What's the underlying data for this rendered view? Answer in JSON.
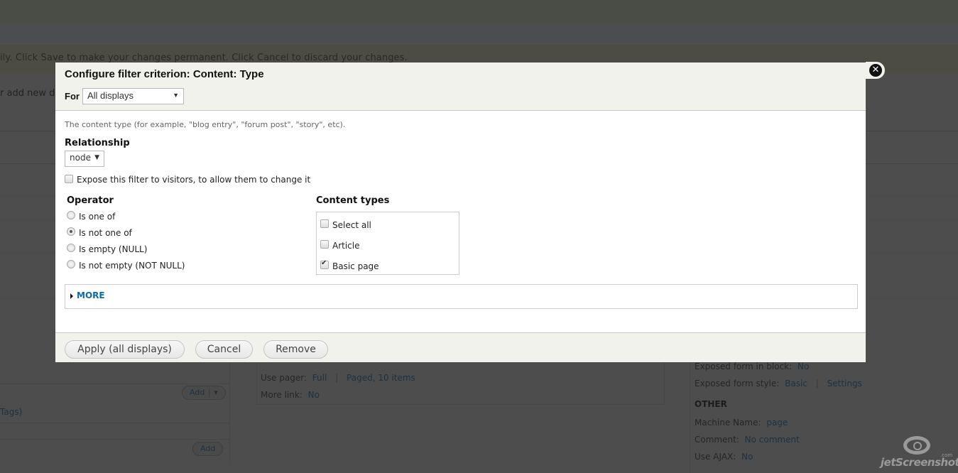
{
  "background": {
    "message": "ily. Click Save to make your changes permanent. Click Cancel to discard your changes.",
    "message2": "r add new d",
    "left_panel": {
      "add_button_1": "Add",
      "tags_text": "Tags)",
      "add_button_2": "Add"
    },
    "center_panel": {
      "use_pager_label": "Use pager:",
      "use_pager_value": "Full",
      "use_pager_value2": "Paged, 10 items",
      "more_link_label": "More link:",
      "more_link_value": "No"
    },
    "right_panel": {
      "exposed_block_label": "Exposed form in block:",
      "exposed_block_value": "No",
      "exposed_style_label": "Exposed form style:",
      "exposed_style_value": "Basic",
      "exposed_style_settings": "Settings",
      "other_heading": "OTHER",
      "machine_name_label": "Machine Name:",
      "machine_name_value": "page",
      "comment_label": "Comment:",
      "comment_value": "No comment",
      "use_ajax_label": "Use AJAX:",
      "use_ajax_value": "No"
    }
  },
  "dialog": {
    "title": "Configure filter criterion: Content: Type",
    "for_label": "For",
    "for_select_value": "All displays",
    "close_icon": "close-icon",
    "description": "The content type (for example, \"blog entry\", \"forum post\", \"story\", etc).",
    "relationship_label": "Relationship",
    "relationship_value": "node",
    "expose_label": "Expose this filter to visitors, to allow them to change it",
    "expose_checked": false,
    "operator_label": "Operator",
    "operators": [
      {
        "label": "Is one of",
        "checked": false
      },
      {
        "label": "Is not one of",
        "checked": true
      },
      {
        "label": "Is empty (NULL)",
        "checked": false
      },
      {
        "label": "Is not empty (NOT NULL)",
        "checked": false
      }
    ],
    "content_types_label": "Content types",
    "content_types": [
      {
        "label": "Select all",
        "checked": false
      },
      {
        "label": "Article",
        "checked": false
      },
      {
        "label": "Basic page",
        "checked": true
      }
    ],
    "more_label": "MORE",
    "buttons": {
      "apply": "Apply (all displays)",
      "cancel": "Cancel",
      "remove": "Remove"
    }
  },
  "watermark": {
    "text": "jetScreenshot",
    "suffix": ".com"
  }
}
